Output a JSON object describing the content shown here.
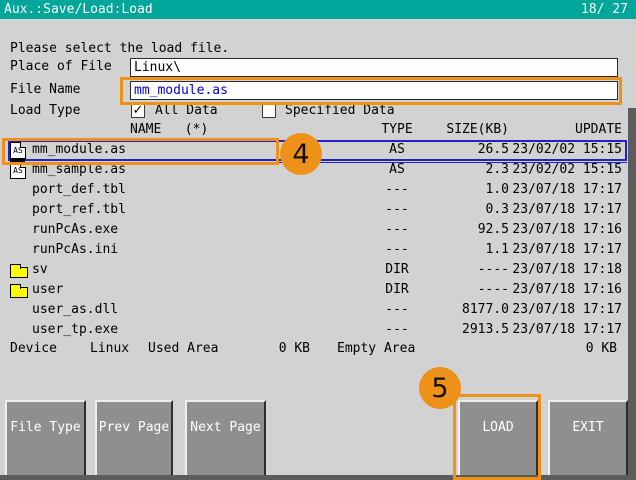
{
  "titlebar": {
    "title": "Aux.:Save/Load:Load",
    "pager": "18/ 27"
  },
  "form": {
    "instruction": "Please select the load file.",
    "place_label": "Place of File",
    "place_value": "Linux\\",
    "filename_label": "File Name",
    "filename_value": "mm_module.as",
    "loadtype_label": "Load Type",
    "all_data_label": "All Data",
    "specified_data_label": "Specified Data"
  },
  "icons": {
    "checkmark": "✓",
    "as_icon_label": "AS"
  },
  "table": {
    "headers": {
      "name": "NAME   (*)",
      "type": "TYPE",
      "size": "SIZE(KB)",
      "update": "UPDATE"
    },
    "rows": [
      {
        "icon": "as-file",
        "name": "mm_module.as",
        "type": "AS",
        "size": "26.5",
        "update": "23/02/02 15:15",
        "selected": true
      },
      {
        "icon": "as-file",
        "name": "mm_sample.as",
        "type": "AS",
        "size": "2.3",
        "update": "23/02/02 15:15"
      },
      {
        "icon": "none",
        "name": "port_def.tbl",
        "type": "---",
        "size": "1.0",
        "update": "23/07/18 17:17"
      },
      {
        "icon": "none",
        "name": "port_ref.tbl",
        "type": "---",
        "size": "0.3",
        "update": "23/07/18 17:17"
      },
      {
        "icon": "none",
        "name": "runPcAs.exe",
        "type": "---",
        "size": "92.5",
        "update": "23/07/18 17:16"
      },
      {
        "icon": "none",
        "name": "runPcAs.ini",
        "type": "---",
        "size": "1.1",
        "update": "23/07/18 17:17"
      },
      {
        "icon": "folder",
        "name": "sv",
        "type": "DIR",
        "size": "----",
        "update": "23/07/18 17:18"
      },
      {
        "icon": "folder",
        "name": "user",
        "type": "DIR",
        "size": "----",
        "update": "23/07/18 17:16"
      },
      {
        "icon": "none",
        "name": "user_as.dll",
        "type": "---",
        "size": "8177.0",
        "update": "23/07/18 17:17"
      },
      {
        "icon": "none",
        "name": "user_tp.exe",
        "type": "---",
        "size": "2913.5",
        "update": "23/07/18 17:17"
      }
    ]
  },
  "status": {
    "device_label": "Device",
    "device_value": "Linux",
    "used_label": "Used Area",
    "used_value": "0 KB",
    "empty_label": "Empty Area",
    "empty_value": "0 KB"
  },
  "buttons": {
    "file_type": "File Type",
    "prev_page": "Prev Page",
    "next_page": "Next Page",
    "load": "LOAD",
    "exit": "EXIT"
  },
  "annotations": {
    "step4": "4",
    "step5": "5"
  },
  "colors": {
    "titlebar_teal": "#00a69a",
    "annotation_orange": "#ee9118",
    "selection_blue": "#2121cc",
    "filename_text_blue": "#0000cc",
    "background_gray": "#d2d2d2",
    "button_gray": "#8f8f8f"
  }
}
